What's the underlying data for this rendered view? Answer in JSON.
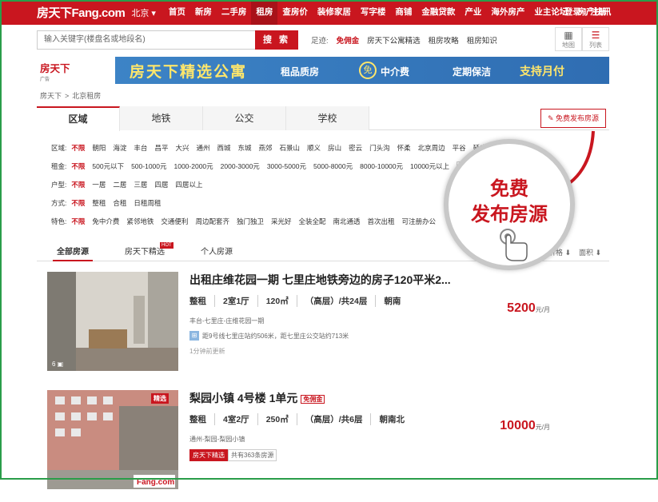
{
  "topnav": {
    "logo": "房天下Fang.com",
    "city": "北京 ▾",
    "items": [
      "首页",
      "新房",
      "二手房",
      "租房",
      "查房价",
      "装修家居",
      "写字楼",
      "商铺",
      "金融贷款",
      "产业",
      "海外房产",
      "业主论坛",
      "房产快讯"
    ],
    "active_index": 3,
    "login": "登录",
    "register": "注册"
  },
  "search": {
    "placeholder": "输入关键字(楼盘名或地段名)",
    "button": "搜 索",
    "footprint_label": "足迹:",
    "footprint_items": [
      "免佣金",
      "房天下公寓精选",
      "租房攻略",
      "租房知识"
    ]
  },
  "view": {
    "map": "地图",
    "list": "列表"
  },
  "banner": {
    "logo": "房天下Fang.com",
    "ad_label": "广告",
    "title": "房天下精选公寓",
    "items": [
      "租品质房",
      "中介费",
      "定期保洁",
      "支持月付"
    ],
    "icon_text": "免"
  },
  "breadcrumb": [
    "房天下",
    "北京租房"
  ],
  "tabs": [
    "区域",
    "地铁",
    "公交",
    "学校"
  ],
  "publish_button": "免费发布房源",
  "filters": {
    "area": {
      "label": "区域:",
      "options": [
        "不限",
        "朝阳",
        "海淀",
        "丰台",
        "昌平",
        "大兴",
        "通州",
        "西城",
        "东城",
        "燕郊",
        "石景山",
        "顺义",
        "房山",
        "密云",
        "门头沟",
        "怀柔",
        "北京周边",
        "平谷",
        "延庆"
      ]
    },
    "rent": {
      "label": "租金:",
      "options": [
        "不限",
        "500元以下",
        "500-1000元",
        "1000-2000元",
        "2000-3000元",
        "3000-5000元",
        "5000-8000元",
        "8000-10000元",
        "10000元以上"
      ],
      "unit": "元"
    },
    "layout": {
      "label": "户型:",
      "options": [
        "不限",
        "一居",
        "二居",
        "三居",
        "四居",
        "四居以上"
      ]
    },
    "mode": {
      "label": "方式:",
      "options": [
        "不限",
        "整租",
        "合租",
        "日租周租"
      ]
    },
    "feature": {
      "label": "特色:",
      "options": [
        "不限",
        "免中介费",
        "紧邻地铁",
        "交通便利",
        "周边配套齐",
        "独门独卫",
        "采光好",
        "全装全配",
        "南北通透",
        "首次出租",
        "可注册办公"
      ]
    }
  },
  "list_tabs": [
    "全部房源",
    "房天下精选",
    "个人房源"
  ],
  "hot_tag": "HOT",
  "sort": [
    "价格",
    "面积"
  ],
  "listings": [
    {
      "title": "出租庄维花园一期 七里庄地铁旁边的房子120平米2...",
      "meta": [
        "整租",
        "2室1厅",
        "120㎡",
        "（高层）/共24层",
        "朝南"
      ],
      "address": "丰台-七里庄-庄维花园一期",
      "subway": "距9号线七里庄站约506米，距七里庄公交站约713米",
      "time": "1分钟前更新",
      "price": "5200",
      "unit": "元/月",
      "photos": "6"
    },
    {
      "title": "梨园小镇 4号楼 1单元",
      "tag": "免佣金",
      "badge": "精选",
      "meta": [
        "整租",
        "4室2厅",
        "250㎡",
        "（高层）/共6层",
        "朝南北"
      ],
      "address": "通州-梨园-梨园小镇",
      "pills": [
        "房天下精选",
        "共有363条房源"
      ],
      "price": "10000",
      "unit": "元/月"
    }
  ],
  "callout": {
    "line1": "免费",
    "line2": "发布房源"
  },
  "colors": {
    "brand": "#c9161f",
    "frame": "#2a9d49"
  }
}
